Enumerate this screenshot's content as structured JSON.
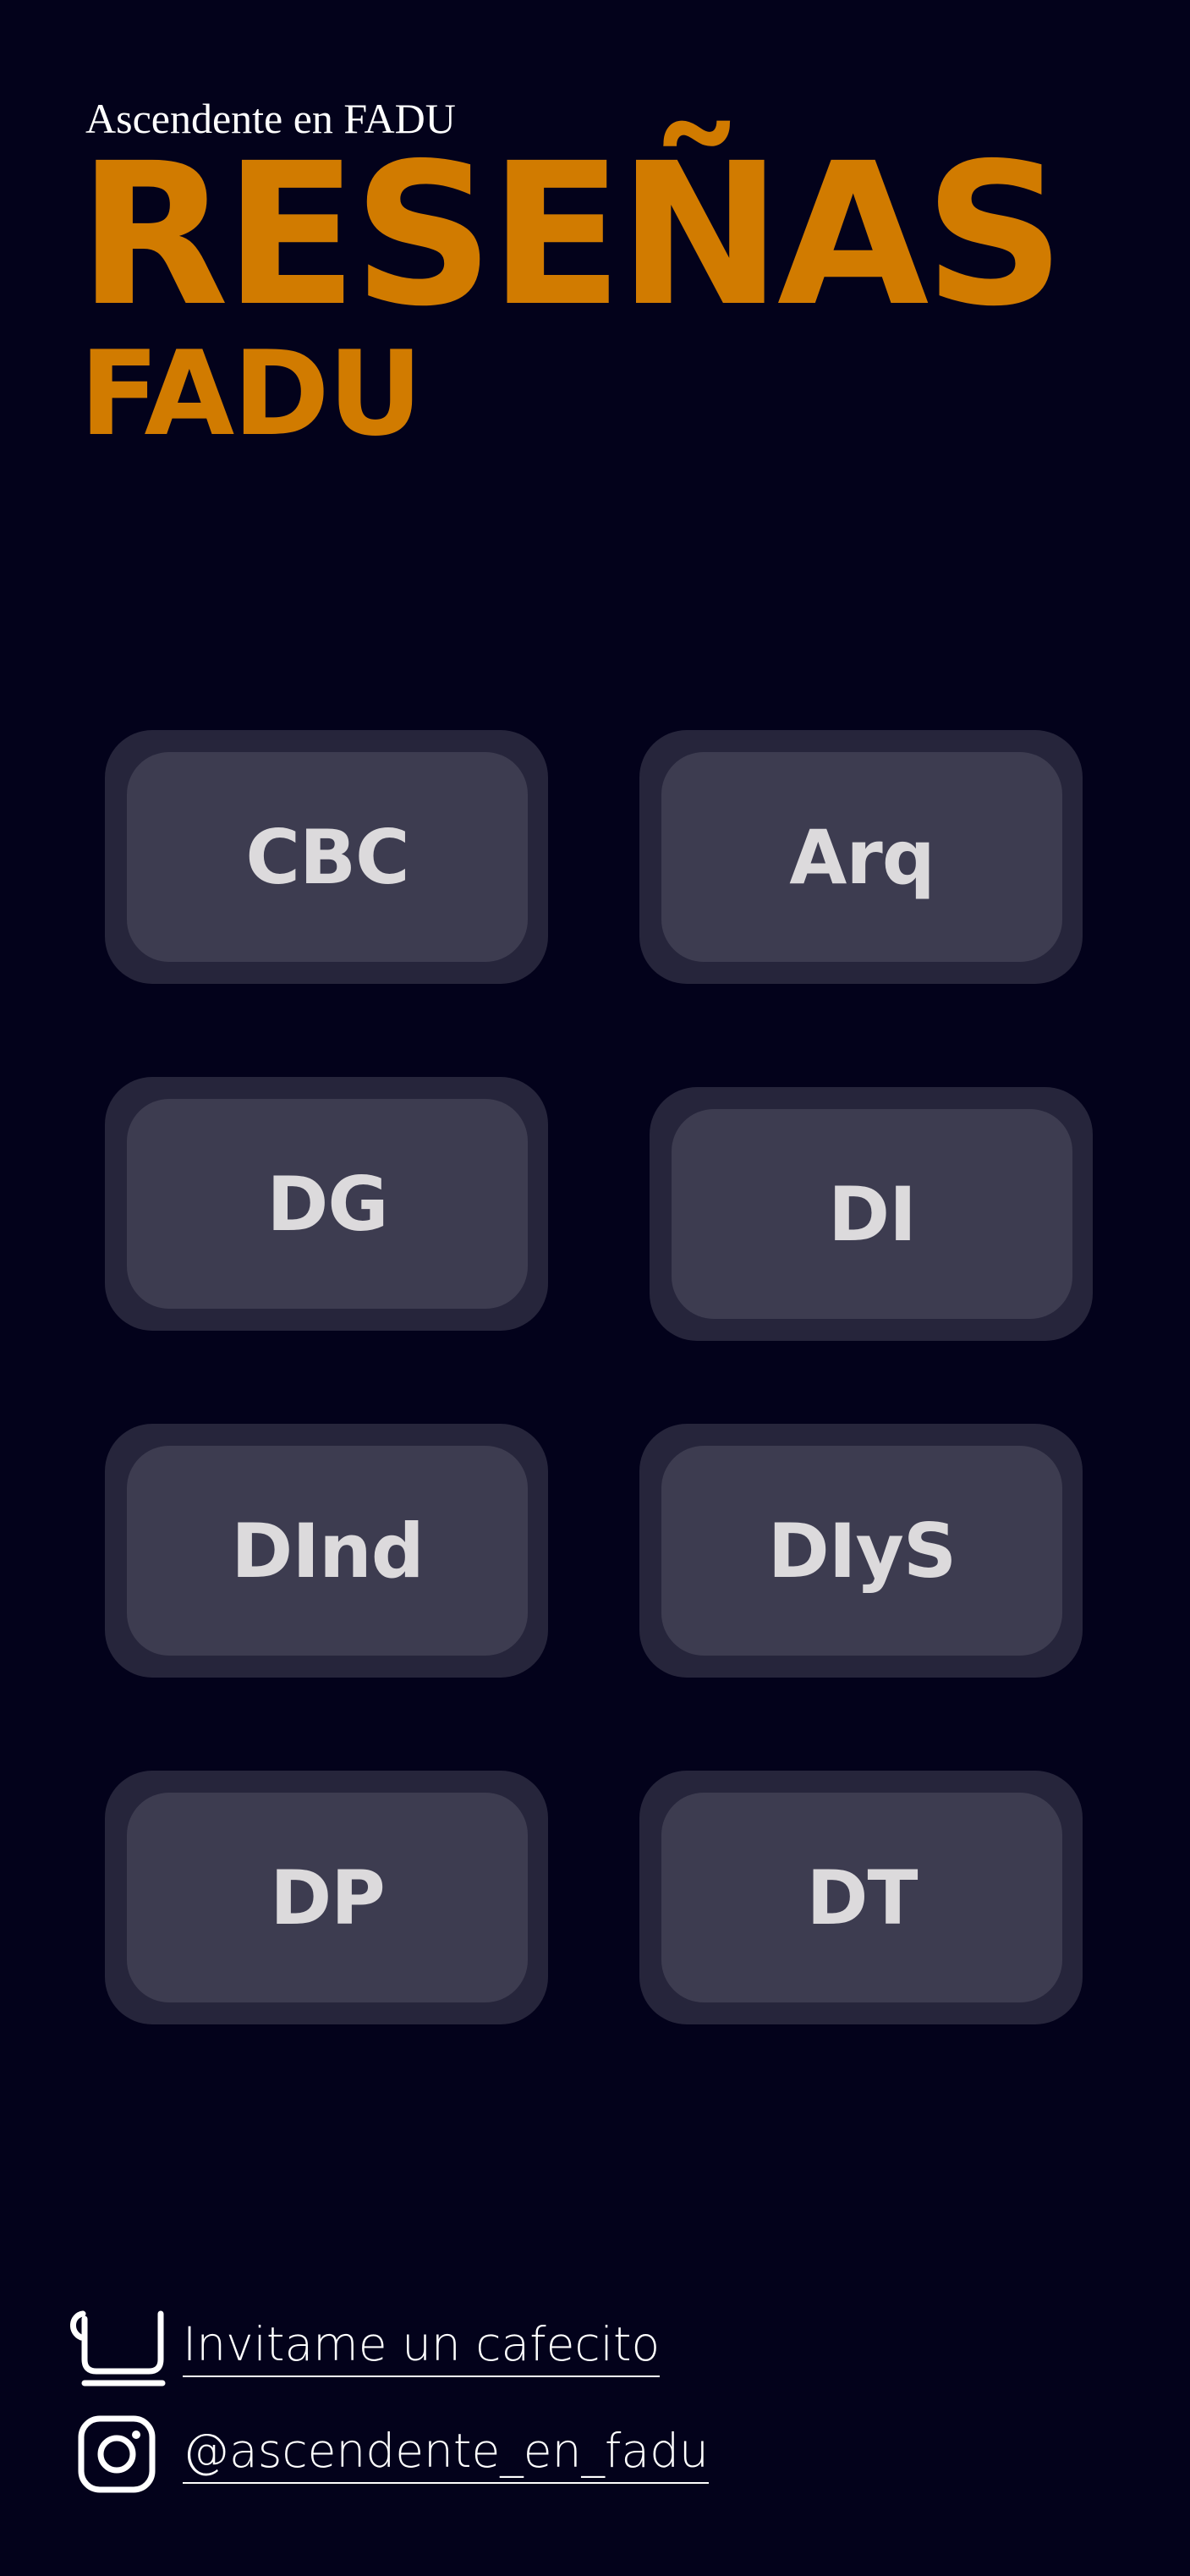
{
  "header": {
    "kicker": "Ascendente en FADU",
    "title": "RESEÑAS",
    "subtitle": "FADU"
  },
  "careers": [
    {
      "label": "CBC"
    },
    {
      "label": "Arq"
    },
    {
      "label": "DG"
    },
    {
      "label": "DI"
    },
    {
      "label": "DInd"
    },
    {
      "label": "DIyS"
    },
    {
      "label": "DP"
    },
    {
      "label": "DT"
    }
  ],
  "footer": {
    "coffee_label": "Invitame un cafecito",
    "coffee_icon": "coffee-cup-icon",
    "instagram_label": "@ascendente_en_fadu",
    "instagram_icon": "instagram-icon"
  },
  "colors": {
    "background": "#03021b",
    "accent": "#d17b00",
    "tile_face": "#3d3c50",
    "tile_shadow": "#26253b",
    "tile_text": "#dcdadc"
  }
}
